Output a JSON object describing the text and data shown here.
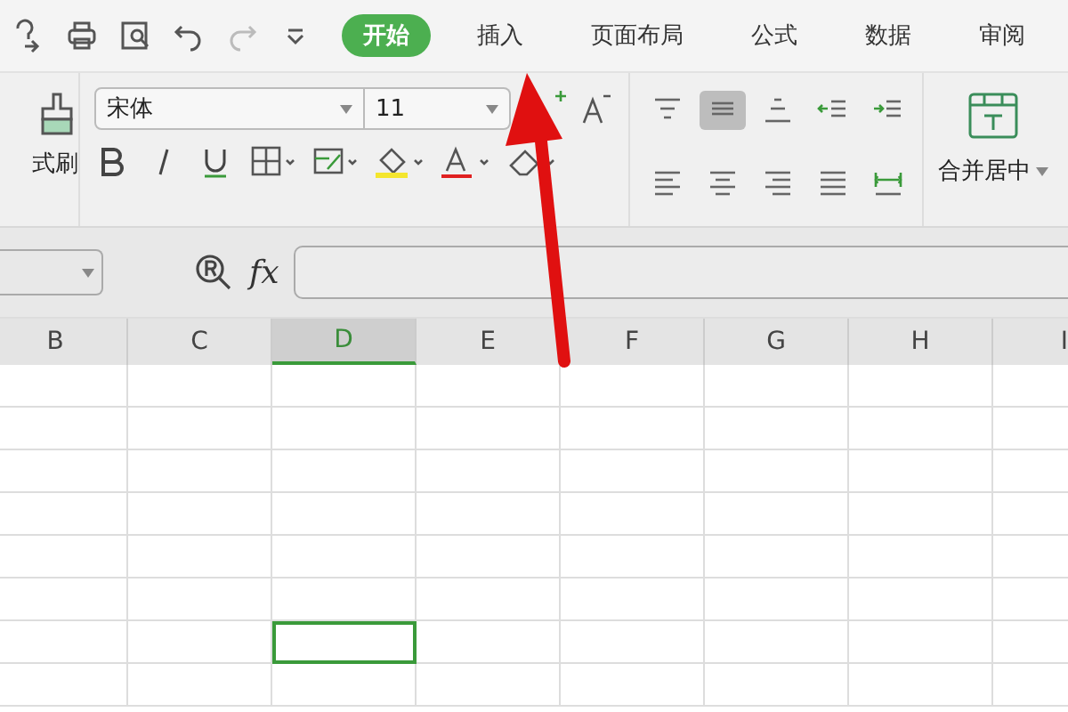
{
  "tabs": [
    {
      "label": "开始",
      "selected": true
    },
    {
      "label": "插入",
      "selected": false
    },
    {
      "label": "页面布局",
      "selected": false
    },
    {
      "label": "公式",
      "selected": false
    },
    {
      "label": "数据",
      "selected": false
    },
    {
      "label": "审阅",
      "selected": false
    }
  ],
  "ribbon": {
    "format_painter_label": "式刷",
    "font_name": "宋体",
    "font_size": "11",
    "merge_label": "合并居中",
    "align_buttons": [
      {
        "kind": "top",
        "selected": false
      },
      {
        "kind": "middle",
        "selected": true
      },
      {
        "kind": "bottom",
        "selected": false
      },
      {
        "kind": "outdent",
        "selected": false
      },
      {
        "kind": "indent",
        "selected": false
      },
      {
        "kind": "left",
        "selected": false
      },
      {
        "kind": "center",
        "selected": false
      },
      {
        "kind": "right",
        "selected": false
      },
      {
        "kind": "justify",
        "selected": false
      },
      {
        "kind": "distribute",
        "selected": false
      }
    ]
  },
  "formula_bar": {
    "fx_label": "fx"
  },
  "sheet": {
    "columns": [
      {
        "label": "B",
        "selected": false
      },
      {
        "label": "C",
        "selected": false
      },
      {
        "label": "D",
        "selected": true
      },
      {
        "label": "E",
        "selected": false
      },
      {
        "label": "F",
        "selected": false
      },
      {
        "label": "G",
        "selected": false
      },
      {
        "label": "H",
        "selected": false
      },
      {
        "label": "I",
        "selected": false
      }
    ],
    "rows": [
      {
        "selected": false
      },
      {
        "selected": false
      },
      {
        "selected": false
      },
      {
        "selected": false
      },
      {
        "selected": false
      },
      {
        "selected": false
      },
      {
        "selected": true
      },
      {
        "selected": false
      }
    ]
  }
}
